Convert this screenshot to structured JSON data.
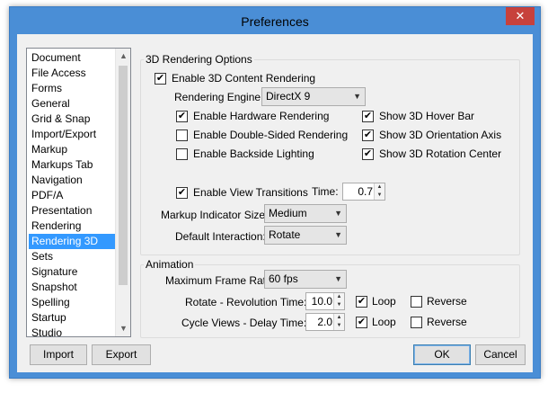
{
  "window": {
    "title": "Preferences",
    "close_glyph": "✕"
  },
  "categories": [
    "Document",
    "File Access",
    "Forms",
    "General",
    "Grid & Snap",
    "Import/Export",
    "Markup",
    "Markups Tab",
    "Navigation",
    "PDF/A",
    "Presentation",
    "Rendering",
    "Rendering 3D",
    "Sets",
    "Signature",
    "Snapshot",
    "Spelling",
    "Startup",
    "Studio"
  ],
  "selected_category": "Rendering 3D",
  "buttons": {
    "import": "Import",
    "export": "Export",
    "ok": "OK",
    "cancel": "Cancel"
  },
  "rendering": {
    "group_title": "3D Rendering Options",
    "enable_3d": {
      "label": "Enable 3D Content Rendering",
      "checked": true
    },
    "engine": {
      "label": "Rendering Engine:",
      "value": "DirectX 9"
    },
    "hardware": {
      "label": "Enable Hardware Rendering",
      "checked": true
    },
    "double_sided": {
      "label": "Enable Double-Sided Rendering",
      "checked": false
    },
    "backside": {
      "label": "Enable Backside Lighting",
      "checked": false
    },
    "hover_bar": {
      "label": "Show 3D Hover Bar",
      "checked": true
    },
    "orientation_axis": {
      "label": "Show 3D Orientation Axis",
      "checked": true
    },
    "rotation_center": {
      "label": "Show 3D Rotation Center",
      "checked": true
    },
    "view_transitions": {
      "label": "Enable View Transitions",
      "checked": true
    },
    "time": {
      "label": "Time:",
      "value": "0.7"
    },
    "markup_indicator": {
      "label": "Markup Indicator Size:",
      "value": "Medium"
    },
    "default_interaction": {
      "label": "Default Interaction:",
      "value": "Rotate"
    }
  },
  "animation": {
    "group_title": "Animation",
    "max_frame_rate": {
      "label": "Maximum Frame Rate:",
      "value": "60 fps"
    },
    "rotate": {
      "label": "Rotate - Revolution Time:",
      "value": "10.0",
      "loop_label": "Loop",
      "loop": true,
      "reverse_label": "Reverse",
      "reverse": false
    },
    "cycle": {
      "label": "Cycle Views - Delay Time:",
      "value": "2.0",
      "loop_label": "Loop",
      "loop": true,
      "reverse_label": "Reverse",
      "reverse": false
    }
  },
  "glyphs": {
    "check": "✔",
    "dropdown": "▼",
    "up": "▲",
    "down": "▼"
  },
  "colors": {
    "titlebar": "#4a8ed6",
    "close": "#c7413c",
    "selection": "#3399ff"
  }
}
